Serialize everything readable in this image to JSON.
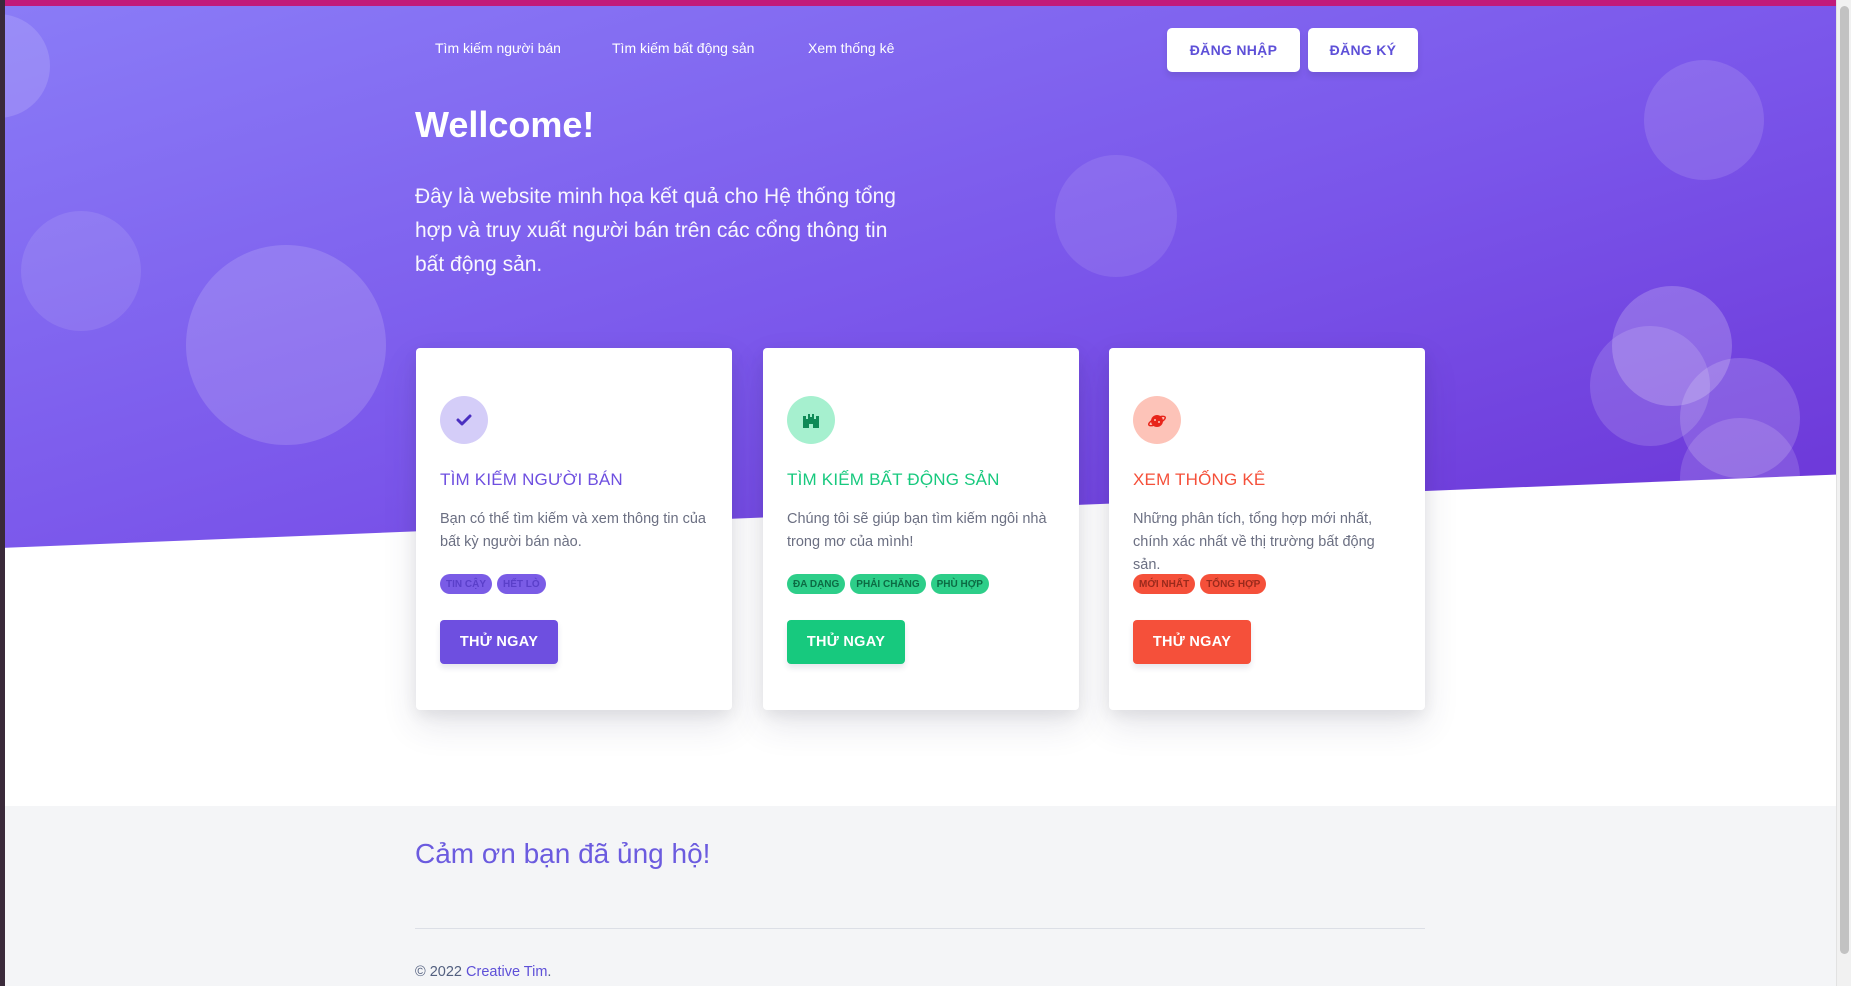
{
  "nav": {
    "links": [
      "Tìm kiếm người bán",
      "Tìm kiếm bất động sản",
      "Xem thống kê"
    ],
    "login_label": "ĐĂNG NHẬP",
    "register_label": "ĐĂNG KÝ"
  },
  "hero": {
    "title": "Wellcome!",
    "lead": "Đây là website minh họa kết quả cho Hệ thống tổng hợp và truy xuất người bán trên các cổng thông tin bất động sản."
  },
  "cards": [
    {
      "icon": "check-icon",
      "title": "TÌM KIẾM NGƯỜI BÁN",
      "description": "Bạn có thể tìm kiếm và xem thông tin của bất kỳ người bán nào.",
      "badges": [
        "TIN CẬY",
        "HẾT LÒ"
      ],
      "button_label": "THỬ NGAY",
      "accent": "#6e4fe0",
      "icon_bg": "#d4cdf8",
      "badge_bg": "#7a5ce6",
      "badge_fg": "#5a3fc9"
    },
    {
      "icon": "castle-icon",
      "title": "TÌM KIẾM BẤT ĐỘNG SẢN",
      "description": "Chúng tôi sẽ giúp bạn tìm kiếm ngôi nhà trong mơ của mình!",
      "badges": [
        "ĐA DẠNG",
        "PHẢI CHĂNG",
        "PHÙ HỢP"
      ],
      "button_label": "THỬ NGAY",
      "accent": "#17c97e",
      "icon_bg": "#a6f0cf",
      "badge_bg": "#2dce89",
      "badge_fg": "#0c6b43"
    },
    {
      "icon": "planet-icon",
      "title": "XEM THỐNG KÊ",
      "description": "Những phân tích, tổng hợp mới nhất, chính xác nhất về thị trường bất động sản.",
      "badges": [
        "MỚI NHẤT",
        "TỔNG HỢP"
      ],
      "button_label": "THỬ NGAY",
      "accent": "#f5503a",
      "icon_bg": "#fdc3b8",
      "badge_bg": "#f5503a",
      "badge_fg": "#9a2a1c"
    }
  ],
  "footer": {
    "title": "Cảm ơn bạn đã ủng hộ!",
    "copyright_prefix": "© 2022",
    "copyright_link": "Creative Tim",
    "copyright_suffix": "."
  }
}
